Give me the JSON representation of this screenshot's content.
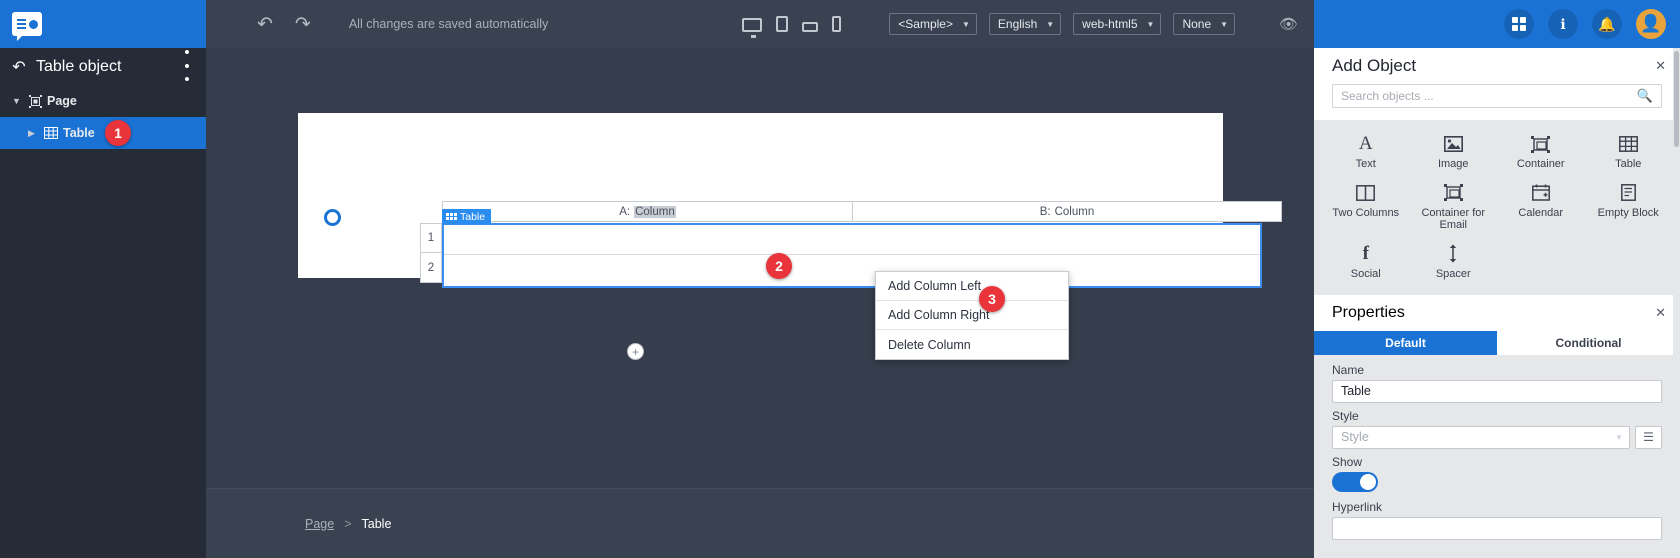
{
  "sidebar": {
    "logo_icon": "app-logo-icon",
    "back_icon": "back-arrow-icon",
    "title": "Table object",
    "menu_icon": "kebab-menu-icon",
    "tree": [
      {
        "label": "Page",
        "icon": "page-icon",
        "caret": "down",
        "badge": null
      },
      {
        "label": "Table",
        "icon": "table-icon",
        "caret": "right",
        "badge": "1"
      }
    ]
  },
  "topbar": {
    "undo_icon": "undo-icon",
    "redo_icon": "redo-icon",
    "save_status": "All changes are saved automatically",
    "devices": [
      "desktop",
      "tablet",
      "tablet-landscape",
      "phone"
    ],
    "selects": [
      {
        "name": "sample-select",
        "value": "<Sample>"
      },
      {
        "name": "language-select",
        "value": "English"
      },
      {
        "name": "output-select",
        "value": "web-html5"
      },
      {
        "name": "theme-select",
        "value": "None"
      }
    ],
    "preview_icon": "eye-icon",
    "apps_icon": "apps-grid-icon",
    "info_icon": "info-icon",
    "bell_icon": "bell-icon",
    "avatar_icon": "user-avatar"
  },
  "canvas": {
    "selection_handle": "radio-select-handle",
    "table_tag": "Table",
    "columns": [
      {
        "prefix": "A:",
        "name": "Column",
        "selected": true
      },
      {
        "prefix": "B:",
        "name": "Column",
        "selected": false
      }
    ],
    "row_numbers": [
      "1",
      "2"
    ],
    "add_column_button": "+",
    "add_row_button": "+",
    "context_menu": [
      "Add Column Left",
      "Add Column Right",
      "Delete Column"
    ],
    "badges": {
      "two": "2",
      "three": "3"
    }
  },
  "breadcrumb": {
    "root": "Page",
    "separator": ">",
    "current": "Table"
  },
  "add_object": {
    "title": "Add Object",
    "collapse_icon": "chevron-up-icon",
    "search_placeholder": "Search objects ...",
    "search_value": "",
    "search_icon": "search-icon",
    "objects": [
      {
        "label": "Text",
        "icon": "text-icon"
      },
      {
        "label": "Image",
        "icon": "image-icon"
      },
      {
        "label": "Container",
        "icon": "container-icon"
      },
      {
        "label": "Table",
        "icon": "table-icon"
      },
      {
        "label": "Two Columns",
        "icon": "two-columns-icon"
      },
      {
        "label": "Container for Email",
        "icon": "container-email-icon"
      },
      {
        "label": "Calendar",
        "icon": "calendar-icon"
      },
      {
        "label": "Empty Block",
        "icon": "empty-block-icon"
      },
      {
        "label": "Social",
        "icon": "social-facebook-icon"
      },
      {
        "label": "Spacer",
        "icon": "spacer-icon"
      }
    ]
  },
  "properties": {
    "title": "Properties",
    "collapse_icon": "chevron-up-icon",
    "tabs": [
      {
        "label": "Default",
        "active": true
      },
      {
        "label": "Conditional",
        "active": false
      }
    ],
    "fields": {
      "name_label": "Name",
      "name_value": "Table",
      "style_label": "Style",
      "style_placeholder": "Style",
      "style_button_icon": "style-editor-icon",
      "show_label": "Show",
      "show_value": "on",
      "hyperlink_label": "Hyperlink",
      "hyperlink_value": ""
    }
  },
  "colors": {
    "brand_blue": "#1a73d4",
    "dark_panel": "#252c38",
    "topbar": "#3a4150",
    "canvas": "#363d4c",
    "badge_red": "#e8343a",
    "panel_grey": "#e6e7e9"
  }
}
